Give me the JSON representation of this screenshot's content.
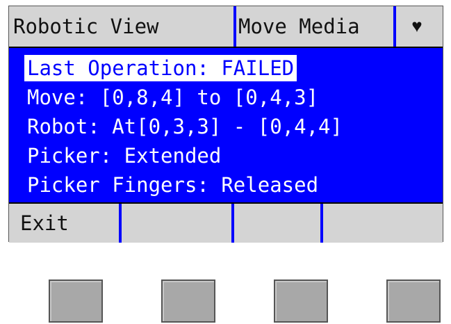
{
  "title_bar": {
    "tab_robotic_view": "Robotic View",
    "tab_move_media": "Move Media",
    "heart_symbol": "♥"
  },
  "status": {
    "last_operation": "Last Operation: FAILED",
    "move": "Move: [0,8,4] to [0,4,3]",
    "robot": "Robot: At[0,3,3] - [0,4,4]",
    "picker": "Picker: Extended",
    "picker_fingers": "Picker Fingers: Released"
  },
  "softkeys": {
    "key1": "Exit",
    "key2": "",
    "key3": "",
    "key4": ""
  },
  "colors": {
    "screen_background": "#0000ff",
    "bar_background": "#d4d4d4",
    "text_on_screen": "#ffffff",
    "hardware_button": "#a8a8a8"
  }
}
